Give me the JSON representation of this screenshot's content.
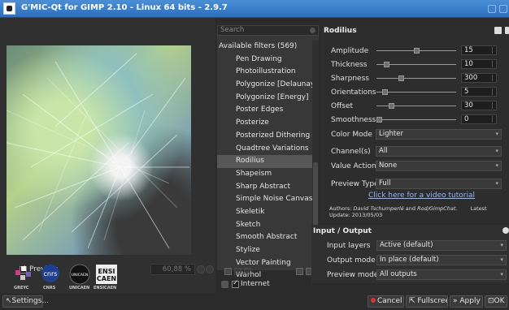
{
  "window": {
    "title": "G'MIC-Qt for GIMP 2.10 - Linux 64 bits - 2.9.7"
  },
  "preview": {
    "checkbox_label": "Preview",
    "checked": true,
    "zoom": "60,88 %"
  },
  "logos": [
    "GREYC",
    "CNRS",
    "UNICAEN",
    "ENSICAEN"
  ],
  "logo_texts": {
    "cnrs": "cnrs",
    "unicaen": "UNICAEN",
    "ensi": "ENSI",
    "caen": "CAEN"
  },
  "settings_label": "Settings...",
  "search": {
    "placeholder": "Search"
  },
  "filter_list": {
    "header": "Available filters (569)",
    "items": [
      "Pen Drawing",
      "Photoillustration",
      "Polygonize [Delaunay]",
      "Polygonize [Energy]",
      "Poster Edges",
      "Posterize",
      "Posterized Dithering",
      "Quadtree Variations",
      "Rodilius",
      "Shapeism",
      "Sharp Abstract",
      "Simple Noise Canvas",
      "Skeletik",
      "Sketch",
      "Smooth Abstract",
      "Stylize",
      "Vector Painting",
      "Warhol"
    ],
    "selected": "Rodilius"
  },
  "internet": {
    "label": "Internet",
    "checked": true
  },
  "filter": {
    "name": "Rodilius",
    "sliders": [
      {
        "label": "Amplitude",
        "value": "15",
        "fraction": 0.5
      },
      {
        "label": "Thickness",
        "value": "10",
        "fraction": 0.1
      },
      {
        "label": "Sharpness",
        "value": "300",
        "fraction": 0.3
      },
      {
        "label": "Orientations",
        "value": "5",
        "fraction": 0.08
      },
      {
        "label": "Offset",
        "value": "30",
        "fraction": 0.17
      },
      {
        "label": "Smoothness",
        "value": "0",
        "fraction": 0.0
      }
    ],
    "color_mode": {
      "label": "Color Mode",
      "value": "Lighter"
    },
    "channels": {
      "label": "Channel(s)",
      "value": "All"
    },
    "value_action": {
      "label": "Value Action",
      "value": "None"
    },
    "preview_type": {
      "label": "Preview Type",
      "value": "Full"
    },
    "video_link": "Click here for a video tutorial",
    "authors_prefix": "Authors: ",
    "authors": "David Tschumperlé",
    "authors_and": " and ",
    "authors2": "Rod/GimpChat.",
    "latest": "Latest",
    "update": "Update: 2013/05/03"
  },
  "io": {
    "title": "Input / Output",
    "input_layers": {
      "label": "Input layers",
      "value": "Active (default)"
    },
    "output_mode": {
      "label": "Output mode",
      "value": "In place (default)"
    },
    "preview_mode": {
      "label": "Preview mode",
      "value": "All outputs"
    }
  },
  "buttons": {
    "cancel": "Cancel",
    "fullscreen": "Fullscreen",
    "apply": "Apply",
    "ok": "OK"
  },
  "colors": {
    "titlebar": "#2c6fbd",
    "selection": "#575757",
    "link": "#8fb8ff",
    "cancel_dot": "#e03030"
  }
}
